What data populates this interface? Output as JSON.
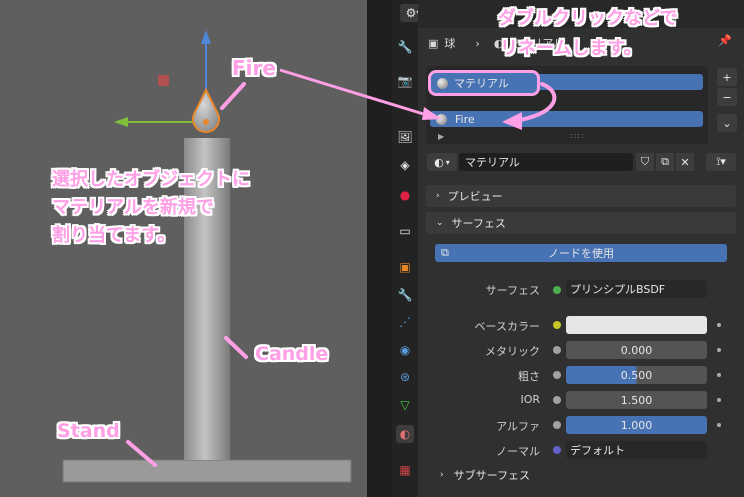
{
  "annotations": {
    "fire_label": "Fire",
    "select_note_line1": "選択したオブジェクトに",
    "select_note_line2": "マテリアルを新規で",
    "select_note_line3": "割り当てます。",
    "candle_label": "Candle",
    "stand_label": "Stand",
    "rename_note_line1": "ダブルクリックなどで",
    "rename_note_line2": "リネームします。"
  },
  "header": {
    "object_name": "球",
    "material_crumb": "マテリアル"
  },
  "slots": {
    "items": [
      "マテリアル",
      "Fire"
    ],
    "add": "+",
    "remove": "−",
    "more": "⌄"
  },
  "material_browser": {
    "name": "マテリアル"
  },
  "panels": {
    "preview": "プレビュー",
    "surface": "サーフェス",
    "use_nodes": "ノードを使用",
    "subsurface": "サブサーフェス"
  },
  "surface": {
    "surface_label": "サーフェス",
    "surface_value": "プリンシプルBSDF",
    "base_color_label": "ベースカラー",
    "metallic_label": "メタリック",
    "metallic_value": "0.000",
    "roughness_label": "粗さ",
    "roughness_value": "0.500",
    "ior_label": "IOR",
    "ior_value": "1.500",
    "alpha_label": "アルファ",
    "alpha_value": "1.000",
    "normal_label": "ノーマル",
    "normal_value": "デフォルト"
  },
  "colors": {
    "accent": "#4772b3",
    "annotation": "#ff9fe6",
    "selection_orange": "#e8862a"
  }
}
